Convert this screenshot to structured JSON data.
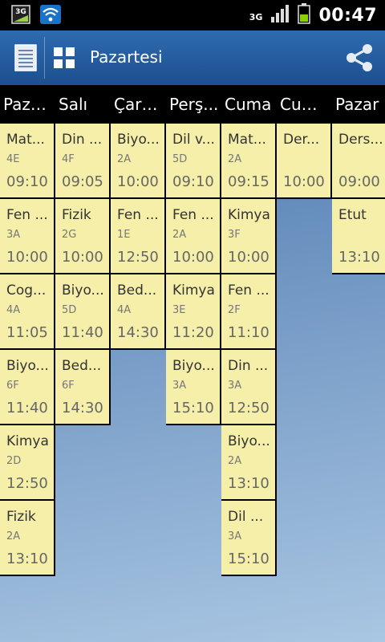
{
  "status_bar": {
    "network": "3G",
    "time": "00:47"
  },
  "action_bar": {
    "title": "Pazartesi"
  },
  "days": [
    "Paza...",
    "Salı",
    "Çarş...",
    "Perş...",
    "Cuma",
    "Cum...",
    "Pazar"
  ],
  "columns": [
    [
      {
        "lesson": "Mat...",
        "room": "4E",
        "time": "09:10"
      },
      {
        "lesson": "Fen ...",
        "room": "3A",
        "time": "10:00"
      },
      {
        "lesson": "Cog...",
        "room": "4A",
        "time": "11:05"
      },
      {
        "lesson": "Biyo...",
        "room": "6F",
        "time": "11:40"
      },
      {
        "lesson": "Kimya",
        "room": "2D",
        "time": "12:50"
      },
      {
        "lesson": "Fizik",
        "room": "2A",
        "time": "13:10"
      }
    ],
    [
      {
        "lesson": "Din ...",
        "room": "4F",
        "time": "09:05"
      },
      {
        "lesson": "Fizik",
        "room": "2G",
        "time": "10:00"
      },
      {
        "lesson": "Biyo...",
        "room": "5D",
        "time": "11:40"
      },
      {
        "lesson": "Bed...",
        "room": "6F",
        "time": "14:30"
      }
    ],
    [
      {
        "lesson": "Biyo...",
        "room": "2A",
        "time": "10:00"
      },
      {
        "lesson": "Fen ...",
        "room": "1E",
        "time": "12:50"
      },
      {
        "lesson": "Bed...",
        "room": "4A",
        "time": "14:30"
      }
    ],
    [
      {
        "lesson": "Dil v...",
        "room": "5D",
        "time": "09:10"
      },
      {
        "lesson": "Fen ...",
        "room": "2A",
        "time": "10:00"
      },
      {
        "lesson": "Kimya",
        "room": "3E",
        "time": "11:20"
      },
      {
        "lesson": "Biyo...",
        "room": "3A",
        "time": "15:10"
      }
    ],
    [
      {
        "lesson": "Mat...",
        "room": "2A",
        "time": "09:15"
      },
      {
        "lesson": "Kimya",
        "room": "3F",
        "time": "10:00"
      },
      {
        "lesson": "Fen ...",
        "room": "2F",
        "time": "11:10"
      },
      {
        "lesson": "Din ...",
        "room": "3A",
        "time": "12:50"
      },
      {
        "lesson": "Biyo...",
        "room": "2A",
        "time": "13:10"
      },
      {
        "lesson": "Dil ...",
        "room": "3A",
        "time": "15:10"
      }
    ],
    [
      {
        "lesson": "Der...",
        "room": "",
        "time": "10:00"
      }
    ],
    [
      {
        "lesson": "Ders...",
        "room": "",
        "time": "09:00"
      },
      {
        "lesson": "Etut",
        "room": "",
        "time": "13:10"
      }
    ]
  ]
}
